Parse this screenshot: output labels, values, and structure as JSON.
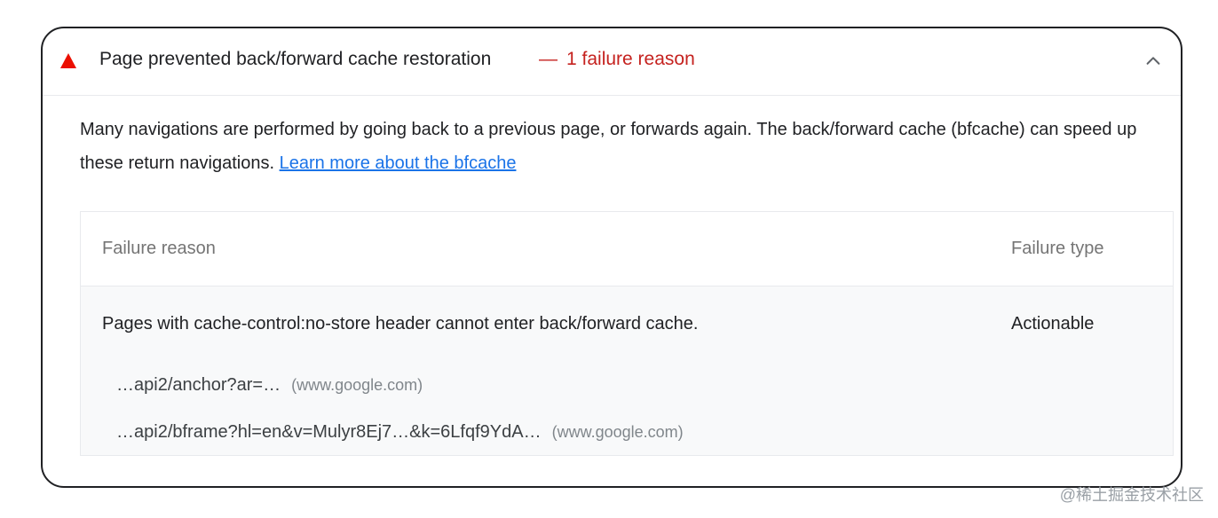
{
  "audit": {
    "title": "Page prevented back/forward cache restoration",
    "display_dash": "—",
    "display_value": "1 failure reason",
    "status_color": "#eb0f00",
    "status_icon": "fail-triangle-icon",
    "expand_icon": "chevron-up-icon"
  },
  "description": {
    "text": "Many navigations are performed by going back to a previous page, or forwards again. The back/forward cache (bfcache) can speed up these return navigations. ",
    "link_text": "Learn more about the bfcache"
  },
  "table": {
    "headers": {
      "reason": "Failure reason",
      "type": "Failure type"
    },
    "rows": [
      {
        "reason": "Pages with cache-control:no-store header cannot enter back/forward cache.",
        "type": "Actionable",
        "subitems": [
          {
            "url": "…api2/anchor?ar=…",
            "origin": "(www.google.com)"
          },
          {
            "url": "…api2/bframe?hl=en&v=Mulyr8Ej7…&k=6Lfqf9YdA…",
            "origin": "(www.google.com)"
          }
        ]
      }
    ]
  },
  "watermark": "@稀土掘金技术社区"
}
